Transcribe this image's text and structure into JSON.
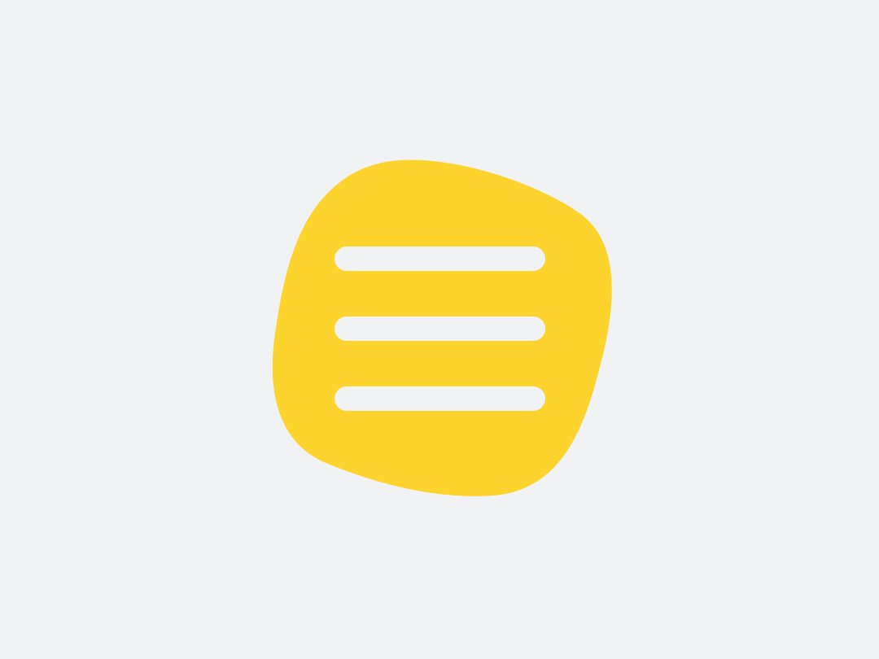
{
  "app_icon": {
    "icon": "hamburger-menu-icon",
    "shape": "rounded-blob",
    "background_color": "#f1f2f4",
    "blob_color": "#fdd42d",
    "bar_color": "#f1f2f4",
    "bar_count": 3
  }
}
